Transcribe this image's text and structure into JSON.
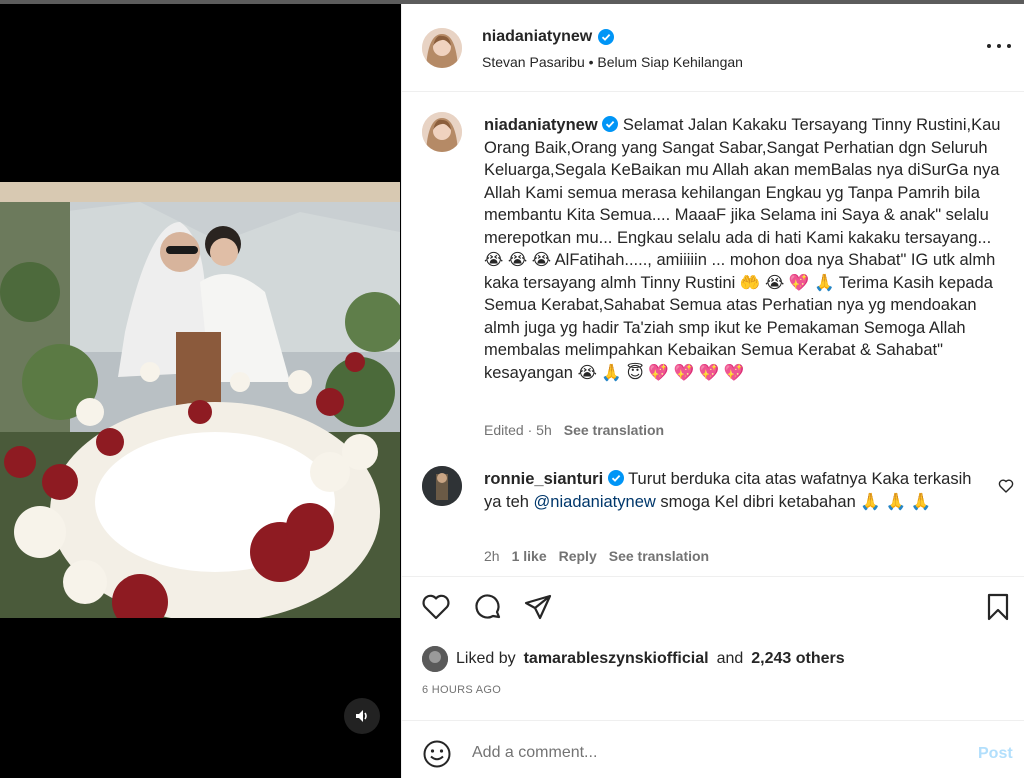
{
  "post": {
    "username": "niadaniatynew",
    "subtitle": "Stevan Pasaribu • Belum Siap Kehilangan",
    "caption": "Selamat Jalan Kakaku Tersayang Tinny Rustini,Kau Orang Baik,Orang yang Sangat Sabar,Sangat Perhatian dgn Seluruh Keluarga,Segala KeBaikan mu Allah akan memBalas nya diSurGa nya Allah Kami semua merasa kehilangan Engkau yg Tanpa Pamrih bila membantu Kita Semua.... MaaaF jika Selama ini Saya & anak\" selalu merepotkan mu... Engkau selalu ada di hati Kami kakaku tersayang... 😭 😭 😭 AlFatihah....., amiiiiin ... mohon doa nya Shabat\" IG utk almh kaka tersayang almh Tinny Rustini 🤲 😭 💖 🙏 Terima Kasih kepada Semua Kerabat,Sahabat Semua atas Perhatian nya yg mendoakan almh juga yg hadir Ta'ziah smp ikut ke Pemakaman Semoga Allah membalas melimpahkan Kebaikan Semua Kerabat & Sahabat\" kesayangan 😭 🙏 😇 💖 💖 💖 💖",
    "caption_meta": {
      "edited": "Edited",
      "time": "5h",
      "see_translation": "See translation"
    }
  },
  "reply": {
    "username": "ronnie_sianturi",
    "text_before": "Turut berduka cita atas wafatnya Kaka terkasih ya teh ",
    "mention": "@niadaniatynew",
    "text_after": " smoga Kel dibri ketabahan 🙏 🙏 🙏",
    "time": "2h",
    "likes": "1 like",
    "reply_label": "Reply",
    "see_translation": "See translation"
  },
  "likes": {
    "prefix": "Liked by",
    "user": "tamarableszynskiofficial",
    "and": "and",
    "others": "2,243 others"
  },
  "timestamp": "6 HOURS AGO",
  "comment": {
    "placeholder": "Add a comment...",
    "post_label": "Post"
  },
  "icons": {
    "verified": "verified-badge-icon",
    "more": "more-options-icon",
    "like": "heart-icon",
    "comment": "comment-icon",
    "share": "share-icon",
    "save": "bookmark-icon",
    "emoji": "emoji-icon",
    "mute": "speaker-icon"
  },
  "colors": {
    "verified": "#0095f6",
    "link": "#00376b",
    "post_disabled": "#b2dffc",
    "muted_text": "#737373"
  }
}
